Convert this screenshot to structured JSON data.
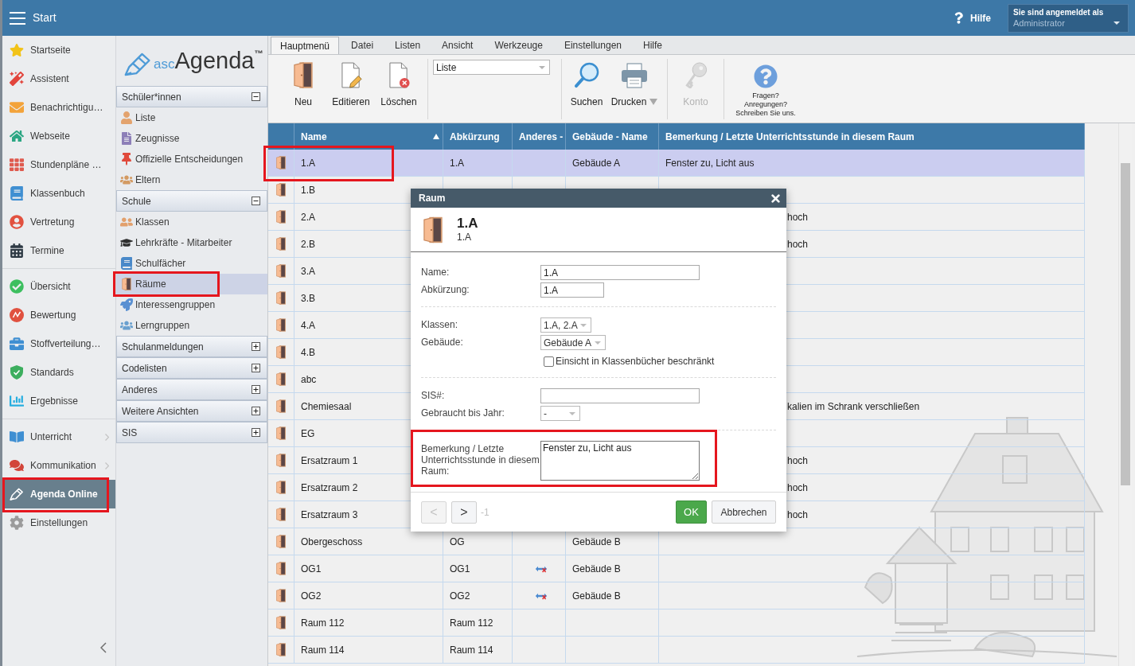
{
  "top_bar": {
    "title": "Start",
    "help": "Hilfe",
    "account": {
      "caption": "Sie sind angemeldet als",
      "user": "Administrator"
    }
  },
  "main_menu": {
    "groups": [
      [
        {
          "label": "Startseite",
          "selected": false,
          "submenu": false,
          "highlighted": false
        },
        {
          "label": "Assistent",
          "selected": false,
          "submenu": false,
          "highlighted": false
        },
        {
          "label": "Benachrichtigu…",
          "selected": false,
          "submenu": false,
          "highlighted": false
        },
        {
          "label": "Webseite",
          "selected": false,
          "submenu": false,
          "highlighted": false
        },
        {
          "label": "Stundenpläne …",
          "selected": false,
          "submenu": false,
          "highlighted": false
        },
        {
          "label": "Klassenbuch",
          "selected": false,
          "submenu": false,
          "highlighted": false
        },
        {
          "label": "Vertretung",
          "selected": false,
          "submenu": false,
          "highlighted": false
        },
        {
          "label": "Termine",
          "selected": false,
          "submenu": false,
          "highlighted": false
        }
      ],
      [
        {
          "label": "Übersicht",
          "selected": false,
          "submenu": false,
          "highlighted": false
        },
        {
          "label": "Bewertung",
          "selected": false,
          "submenu": false,
          "highlighted": false
        },
        {
          "label": "Stoffverteilung…",
          "selected": false,
          "submenu": false,
          "highlighted": false
        },
        {
          "label": "Standards",
          "selected": false,
          "submenu": false,
          "highlighted": false
        },
        {
          "label": "Ergebnisse",
          "selected": false,
          "submenu": false,
          "highlighted": false
        }
      ],
      [
        {
          "label": "Unterricht",
          "selected": false,
          "submenu": true,
          "highlighted": false
        },
        {
          "label": "Kommunikation",
          "selected": false,
          "submenu": true,
          "highlighted": false
        },
        {
          "label": "Agenda Online",
          "selected": true,
          "submenu": false,
          "highlighted": true
        },
        {
          "label": "Einstellungen",
          "selected": false,
          "submenu": false,
          "highlighted": false
        }
      ]
    ]
  },
  "nav_panel": {
    "logo": {
      "prefix": "asc",
      "name": "Agenda",
      "mark": "™"
    },
    "sections": [
      {
        "title": "Schüler*innen",
        "expanded": true,
        "items": [
          {
            "label": "Liste",
            "selected": false,
            "highlighted": false
          },
          {
            "label": "Zeugnisse",
            "selected": false,
            "highlighted": false
          },
          {
            "label": "Offizielle Entscheidungen",
            "selected": false,
            "highlighted": false
          },
          {
            "label": "Eltern",
            "selected": false,
            "highlighted": false
          }
        ]
      },
      {
        "title": "Schule",
        "expanded": true,
        "items": [
          {
            "label": "Klassen",
            "selected": false,
            "highlighted": false
          },
          {
            "label": "Lehrkräfte - Mitarbeiter",
            "selected": false,
            "highlighted": false
          },
          {
            "label": "Schulfächer",
            "selected": false,
            "highlighted": false
          },
          {
            "label": "Räume",
            "selected": true,
            "highlighted": true
          },
          {
            "label": "Interessengruppen",
            "selected": false,
            "highlighted": false
          },
          {
            "label": "Lerngruppen",
            "selected": false,
            "highlighted": false
          }
        ]
      },
      {
        "title": "Schulanmeldungen",
        "expanded": false
      },
      {
        "title": "Codelisten",
        "expanded": false
      },
      {
        "title": "Anderes",
        "expanded": false
      },
      {
        "title": "Weitere Ansichten",
        "expanded": false
      },
      {
        "title": "SIS",
        "expanded": false
      }
    ]
  },
  "ribbon": {
    "tabs": [
      {
        "label": "Hauptmenü",
        "selected": true
      },
      {
        "label": "Datei",
        "selected": false
      },
      {
        "label": "Listen",
        "selected": false
      },
      {
        "label": "Ansicht",
        "selected": false
      },
      {
        "label": "Werkzeuge",
        "selected": false
      },
      {
        "label": "Einstellungen",
        "selected": false
      },
      {
        "label": "Hilfe",
        "selected": false
      }
    ],
    "groups": [
      {
        "kind": "buttons",
        "buttons": [
          {
            "label": "Neu",
            "disabled": false,
            "dropdown": false
          },
          {
            "label": "Editieren",
            "disabled": false,
            "dropdown": false
          },
          {
            "label": "Löschen",
            "disabled": false,
            "dropdown": false
          }
        ]
      },
      {
        "kind": "select",
        "value": "Liste"
      },
      {
        "kind": "buttons",
        "buttons": [
          {
            "label": "Suchen",
            "disabled": false,
            "dropdown": false
          },
          {
            "label": "Drucken",
            "disabled": false,
            "dropdown": true
          }
        ]
      },
      {
        "kind": "buttons",
        "buttons": [
          {
            "label": "Konto",
            "disabled": true,
            "dropdown": false
          }
        ]
      },
      {
        "kind": "feedback",
        "lines": [
          "Fragen?",
          "Anregungen?",
          "Schreiben Sie uns."
        ]
      }
    ]
  },
  "table": {
    "columns": [
      {
        "label": "Name",
        "sorted": true
      },
      {
        "label": "Abkürzung",
        "sorted": false
      },
      {
        "label": "Anderes -",
        "sorted": false
      },
      {
        "label": "Gebäude - Name",
        "sorted": false
      },
      {
        "label": "Bemerkung / Letzte Unterrichtsstunde in diesem Raum",
        "sorted": false
      }
    ],
    "rows": [
      {
        "name": "1.A",
        "abbreviation": "1.A",
        "building": "Gebäude A",
        "remark": "Fenster zu, Licht aus",
        "anderes_flag": false,
        "selected": true,
        "highlighted": true
      },
      {
        "name": "1.B",
        "anderes_flag": false,
        "selected": false,
        "highlighted": false
      },
      {
        "name": "2.A",
        "remark": "hoch",
        "anderes_flag": false,
        "selected": false,
        "highlighted": false
      },
      {
        "name": "2.B",
        "remark": "hoch",
        "anderes_flag": false,
        "selected": false,
        "highlighted": false
      },
      {
        "name": "3.A",
        "anderes_flag": false,
        "selected": false,
        "highlighted": false
      },
      {
        "name": "3.B",
        "anderes_flag": false,
        "selected": false,
        "highlighted": false
      },
      {
        "name": "4.A",
        "anderes_flag": false,
        "selected": false,
        "highlighted": false
      },
      {
        "name": "4.B",
        "anderes_flag": false,
        "selected": false,
        "highlighted": false
      },
      {
        "name": "abc",
        "anderes_flag": false,
        "selected": false,
        "highlighted": false
      },
      {
        "name": "Chemiesaal",
        "remark": "kalien im Schrank verschließen",
        "anderes_flag": false,
        "selected": false,
        "highlighted": false
      },
      {
        "name": "EG",
        "anderes_flag": false,
        "selected": false,
        "highlighted": false
      },
      {
        "name": "Ersatzraum 1",
        "remark": "hoch",
        "anderes_flag": false,
        "selected": false,
        "highlighted": false
      },
      {
        "name": "Ersatzraum 2",
        "remark": "hoch",
        "anderes_flag": false,
        "selected": false,
        "highlighted": false
      },
      {
        "name": "Ersatzraum 3",
        "remark": "hoch",
        "anderes_flag": false,
        "selected": false,
        "highlighted": false
      },
      {
        "name": "Obergeschoss",
        "abbreviation": "OG",
        "building": "Gebäude B",
        "anderes_flag": false,
        "selected": false,
        "highlighted": false
      },
      {
        "name": "OG1",
        "abbreviation": "OG1",
        "building": "Gebäude B",
        "anderes_flag": true,
        "selected": false,
        "highlighted": false
      },
      {
        "name": "OG2",
        "abbreviation": "OG2",
        "building": "Gebäude B",
        "anderes_flag": true,
        "selected": false,
        "highlighted": false
      },
      {
        "name": "Raum 112",
        "abbreviation": "Raum 112",
        "anderes_flag": false,
        "selected": false,
        "highlighted": false
      },
      {
        "name": "Raum 114",
        "abbreviation": "Raum 114",
        "anderes_flag": false,
        "selected": false,
        "highlighted": false
      }
    ]
  },
  "dialog": {
    "title": "Raum",
    "heading": "1.A",
    "subheading": "1.A",
    "sections": [
      [
        {
          "kind": "text",
          "label": "Name:",
          "value": "1.A",
          "highlighted": false
        },
        {
          "kind": "text",
          "label": "Abkürzung:",
          "value": "1.A",
          "highlighted": false
        }
      ],
      [
        {
          "kind": "select",
          "label": "Klassen:",
          "value": "1.A, 2.A",
          "highlighted": false
        },
        {
          "kind": "select",
          "label": "Gebäude:",
          "value": "Gebäude A",
          "highlighted": false
        },
        {
          "kind": "checkbox",
          "label": "Einsicht in Klassenbücher beschränkt",
          "checked": false,
          "highlighted": false
        }
      ],
      [
        {
          "kind": "text",
          "label": "SIS#:",
          "highlighted": false
        },
        {
          "kind": "select",
          "label": "Gebraucht bis Jahr:",
          "value": "-",
          "highlighted": false
        }
      ],
      [
        {
          "kind": "textarea",
          "label": "Bemerkung / Letzte Unterrichtsstunde in diesem Raum:",
          "value": "Fenster zu, Licht aus",
          "highlighted": true
        }
      ]
    ],
    "footer": {
      "previous": {
        "label": "<",
        "disabled": true
      },
      "next": {
        "label": ">",
        "disabled": false
      },
      "counter": "-1",
      "buttons": [
        {
          "label": "OK",
          "kind": "primary"
        },
        {
          "label": "Abbrechen",
          "kind": "secondary"
        }
      ]
    }
  }
}
